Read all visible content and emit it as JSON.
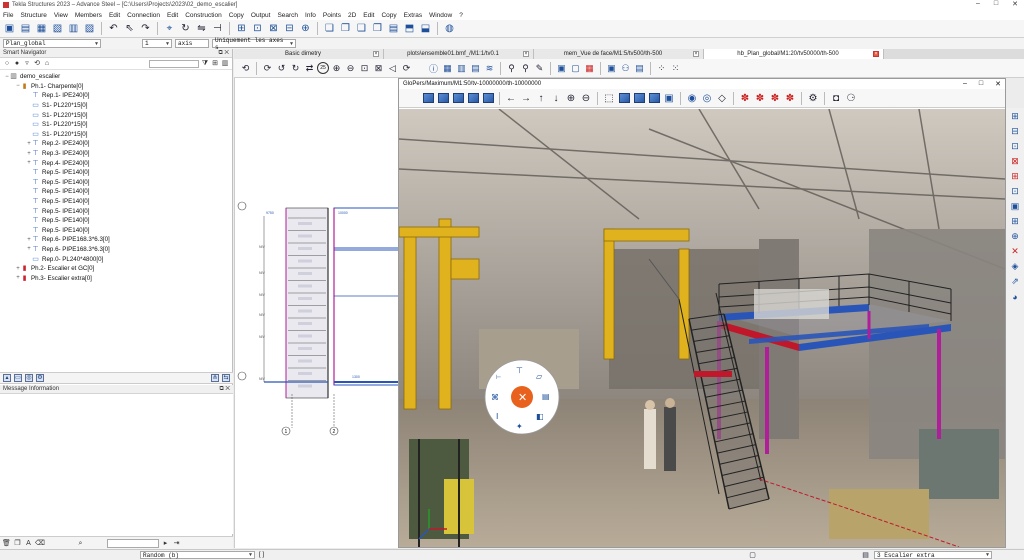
{
  "window": {
    "title": "Tekla Structures 2023 – Advance Steel – [C:\\Users\\Projects\\2023\\02_demo_escalier]",
    "controls": [
      "–",
      "□",
      "✕"
    ]
  },
  "menu": [
    "File",
    "Structure",
    "View",
    "Members",
    "Edit",
    "Connection",
    "Edit",
    "Construction",
    "Copy",
    "Output",
    "Search",
    "Info",
    "Points",
    "2D",
    "Edit",
    "Copy",
    "Extras",
    "Window",
    "?"
  ],
  "toolbar2": {
    "view_combo": "Plan_global",
    "layer_combo": "1",
    "axis_combo": "axis",
    "filter_combo": "Uniquement les axes s"
  },
  "navigator": {
    "title": "Smart Navigator",
    "title_buttons": "⧉ ✕",
    "tree": [
      {
        "label": "demo_escalier",
        "level": 0,
        "exp": "−",
        "icon": "root"
      },
      {
        "label": "Ph.1- Charpente[0]",
        "level": 1,
        "exp": "−",
        "icon": "ph"
      },
      {
        "label": "Rep.1- IPE240[0]",
        "level": 2,
        "exp": "",
        "icon": "beam"
      },
      {
        "label": "S1- PL220*15[0]",
        "level": 2,
        "exp": "",
        "icon": "plate"
      },
      {
        "label": "S1- PL220*15[0]",
        "level": 2,
        "exp": "",
        "icon": "plate"
      },
      {
        "label": "S1- PL220*15[0]",
        "level": 2,
        "exp": "",
        "icon": "plate"
      },
      {
        "label": "S1- PL220*15[0]",
        "level": 2,
        "exp": "",
        "icon": "plate"
      },
      {
        "label": "Rep.2- IPE240[0]",
        "level": 2,
        "exp": "+",
        "icon": "beam"
      },
      {
        "label": "Rep.3- IPE240[0]",
        "level": 2,
        "exp": "+",
        "icon": "beam"
      },
      {
        "label": "Rep.4- IPE240[0]",
        "level": 2,
        "exp": "+",
        "icon": "beam"
      },
      {
        "label": "Rep.5- IPE140[0]",
        "level": 2,
        "exp": "",
        "icon": "beam"
      },
      {
        "label": "Rep.5- IPE140[0]",
        "level": 2,
        "exp": "",
        "icon": "beam"
      },
      {
        "label": "Rep.5- IPE140[0]",
        "level": 2,
        "exp": "",
        "icon": "beam"
      },
      {
        "label": "Rep.5- IPE140[0]",
        "level": 2,
        "exp": "",
        "icon": "beam"
      },
      {
        "label": "Rep.5- IPE140[0]",
        "level": 2,
        "exp": "",
        "icon": "beam"
      },
      {
        "label": "Rep.5- IPE140[0]",
        "level": 2,
        "exp": "",
        "icon": "beam"
      },
      {
        "label": "Rep.5- IPE140[0]",
        "level": 2,
        "exp": "",
        "icon": "beam"
      },
      {
        "label": "Rep.6- PIPE168.3*6.3[0]",
        "level": 2,
        "exp": "+",
        "icon": "beam"
      },
      {
        "label": "Rep.6- PIPE168.3*6.3[0]",
        "level": 2,
        "exp": "+",
        "icon": "beam"
      },
      {
        "label": "Rep.0- PL240*4800[0]",
        "level": 2,
        "exp": "",
        "icon": "plate"
      },
      {
        "label": "Ph.2- Escalier et GC[0]",
        "level": 1,
        "exp": "+",
        "icon": "ph2"
      },
      {
        "label": "Ph.3- Escalier extra[0]",
        "level": 1,
        "exp": "+",
        "icon": "ph2"
      }
    ]
  },
  "message_panel": {
    "title": "Message Information",
    "title_buttons": "⧉ ✕"
  },
  "tabs": [
    {
      "label": "Basic dimetry",
      "active": false,
      "width": 150
    },
    {
      "label": "plots\\ensemble01.bmf_/M1:1/tv0.1",
      "active": false,
      "width": 150
    },
    {
      "label": "mem_Vue de face/M1:5/tv500/th-500",
      "active": false,
      "width": 170
    },
    {
      "label": "hb_Plan_global/M1:20/tv50000/th-500",
      "active": true,
      "width": 180
    }
  ],
  "window3d": {
    "title": "GloPers/Maximum/M1:50/tv-10000000/th-10000000",
    "controls": [
      "–",
      "□",
      "✕"
    ]
  },
  "drawing": {
    "levels": [
      "NIV",
      "NIV",
      "NIV",
      "NIV",
      "NIV",
      "NIV"
    ],
    "grid_labels": [
      "1",
      "2"
    ],
    "dims": [
      "9750",
      "10000",
      "1300"
    ]
  },
  "status": {
    "mode_combo": "Random (b)",
    "brackets": "[ ]",
    "phase_combo": "3   Escalier extra"
  },
  "colors": {
    "accent_blue": "#1d4f9a",
    "steel_blue": "#2a55b8",
    "steel_red": "#c0182a",
    "steel_magenta": "#b01e9a",
    "orange": "#e8621d"
  }
}
